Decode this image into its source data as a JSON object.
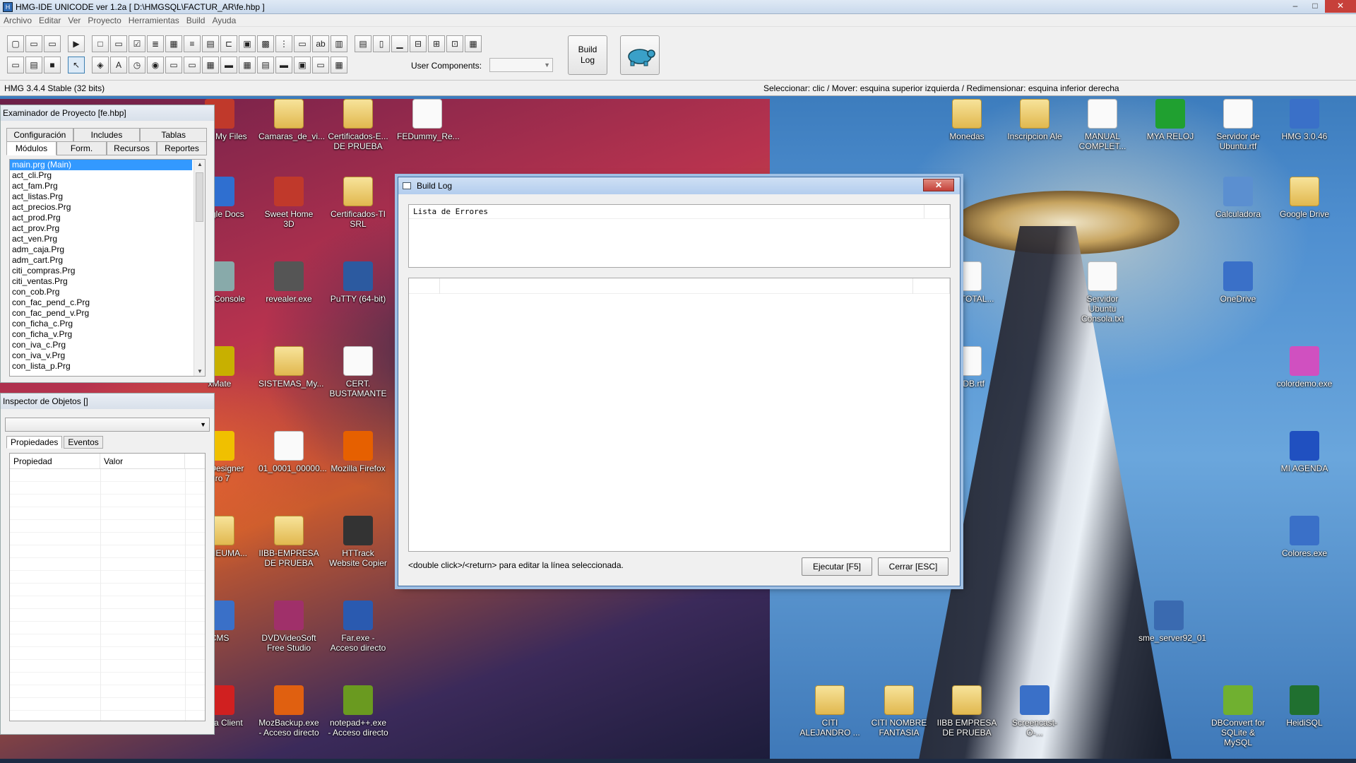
{
  "titlebar": {
    "title": "HMG-IDE  UNICODE  ver 1.2a  [ D:\\HMGSQL\\FACTUR_AR\\fe.hbp ]"
  },
  "menu": [
    "Archivo",
    "Editar",
    "Ver",
    "Proyecto",
    "Herramientas",
    "Build",
    "Ayuda"
  ],
  "toolbar": {
    "user_components_label": "User Components:",
    "build_log_label": "Build\nLog"
  },
  "statusbar": {
    "left": "HMG 3.4.4 Stable (32 bits)",
    "right": "Seleccionar: clic / Mover: esquina superior izquierda / Redimensionar: esquina inferior derecha"
  },
  "project": {
    "title": "Examinador de Proyecto [fe.hbp]",
    "tabs_top": [
      "Configuración",
      "Includes",
      "Tablas"
    ],
    "tabs_bottom": [
      "Módulos",
      "Form.",
      "Recursos",
      "Reportes"
    ],
    "modules": [
      "main.prg (Main)",
      "act_cli.Prg",
      "act_fam.Prg",
      "act_listas.Prg",
      "act_precios.Prg",
      "act_prod.Prg",
      "act_prov.Prg",
      "act_ven.Prg",
      "adm_caja.Prg",
      "adm_cart.Prg",
      "citi_compras.Prg",
      "citi_ventas.Prg",
      "con_cob.Prg",
      "con_fac_pend_c.Prg",
      "con_fac_pend_v.Prg",
      "con_ficha_c.Prg",
      "con_ficha_v.Prg",
      "con_iva_c.Prg",
      "con_iva_v.Prg",
      "con_lista_p.Prg"
    ]
  },
  "inspector": {
    "title": "Inspector de Objetos []",
    "tabs": [
      "Propiedades",
      "Eventos"
    ],
    "columns": [
      "Propiedad",
      "Valor"
    ]
  },
  "buildlog": {
    "title": "Build Log",
    "errors_header": "Lista de Errores",
    "hint": "<double click>/<return> para editar la línea seleccionada.",
    "run_button": "Ejecutar [F5]",
    "close_button": "Cerrar [ESC]"
  },
  "desktop_icons": [
    {
      "label": "cover My Files"
    },
    {
      "label": "Camaras_de_vi..."
    },
    {
      "label": "Certificados-E... DE PRUEBA"
    },
    {
      "label": "FEDummy_Re..."
    },
    {
      "label": "Google Docs"
    },
    {
      "label": "Sweet Home 3D"
    },
    {
      "label": "Certificados-TI SRL"
    },
    {
      "label": "Hgtk Console"
    },
    {
      "label": "revealer.exe"
    },
    {
      "label": "PuTTY (64-bit)"
    },
    {
      "label": "xMate"
    },
    {
      "label": "SISTEMAS_My..."
    },
    {
      "label": "CERT. BUSTAMANTE"
    },
    {
      "label": "ara Designer Pro 7"
    },
    {
      "label": "01_0001_00000..."
    },
    {
      "label": "Mozilla Firefox"
    },
    {
      "label": "CO_NEUMA..."
    },
    {
      "label": "IIBB-EMPRESA DE PRUEBA"
    },
    {
      "label": "HTTrack Website Copier"
    },
    {
      "label": "CMS"
    },
    {
      "label": "DVDVideoSoft Free Studio"
    },
    {
      "label": "Far.exe - Acceso directo"
    },
    {
      "label": "leZilla Client"
    },
    {
      "label": "MozBackup.exe - Acceso directo"
    },
    {
      "label": "notepad++.exe - Acceso directo"
    },
    {
      "label": "Monedas"
    },
    {
      "label": "Inscripcion Ale"
    },
    {
      "label": "MANUAL COMPLET..."
    },
    {
      "label": "MYA RELOJ"
    },
    {
      "label": "Servidor de Ubuntu.rtf"
    },
    {
      "label": "HMG 3.0.46"
    },
    {
      "label": "Calculadora"
    },
    {
      "label": "Google Drive"
    },
    {
      "label": "ALE_TOTAL..."
    },
    {
      "label": "Servidor Ubuntu Consola.txt"
    },
    {
      "label": "OneDrive"
    },
    {
      "label": "letoDB.rtf"
    },
    {
      "label": "colordemo.exe"
    },
    {
      "label": "MI AGENDA"
    },
    {
      "label": "Colores.exe"
    },
    {
      "label": "sme_server92_01"
    },
    {
      "label": "CITI ALEJANDRO ..."
    },
    {
      "label": "CITI NOMBRE FANTASIA"
    },
    {
      "label": "IIBB EMPRESA DE PRUEBA"
    },
    {
      "label": "Screencast-O-..."
    },
    {
      "label": "DBConvert for SQLite & MySQL"
    },
    {
      "label": "HeidiSQL"
    }
  ]
}
